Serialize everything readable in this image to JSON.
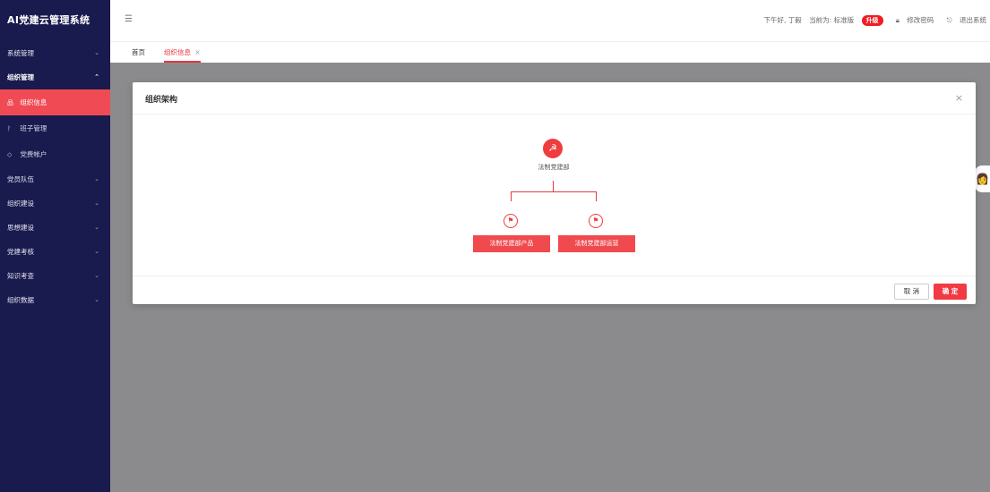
{
  "app": {
    "title": "AI党建云管理系统"
  },
  "sidebar": {
    "items": [
      {
        "label": "系统管理",
        "chevron": "⌄"
      },
      {
        "label": "组织管理",
        "chevron": "⌃"
      },
      {
        "label": "组织信息",
        "icon": "品"
      },
      {
        "label": "班子管理",
        "icon": "ᚹ"
      },
      {
        "label": "党费帐户",
        "icon": "◇"
      },
      {
        "label": "党员队伍",
        "chevron": "⌄"
      },
      {
        "label": "组织建设",
        "chevron": "⌄"
      },
      {
        "label": "思想建设",
        "chevron": "⌄"
      },
      {
        "label": "党建考核",
        "chevron": "⌄"
      },
      {
        "label": "知识考查",
        "chevron": "⌄"
      },
      {
        "label": "组织数据",
        "chevron": "⌄"
      }
    ]
  },
  "header": {
    "greeting": "下午好, 丁毅",
    "version_label": "当前为: 标准版",
    "upgrade": "升级",
    "change_password": "修改密码",
    "logout": "退出系统"
  },
  "tabs": [
    {
      "label": "首页"
    },
    {
      "label": "组织信息",
      "close": "×"
    }
  ],
  "modal": {
    "title": "组织架构",
    "close": "×",
    "cancel": "取 消",
    "ok": "确 定"
  },
  "org": {
    "root": "法制党建部",
    "children": [
      "法制党建部产品",
      "法制党建部运营"
    ]
  },
  "colors": {
    "sidebar": "#191a4e",
    "accent": "#f04b54"
  }
}
